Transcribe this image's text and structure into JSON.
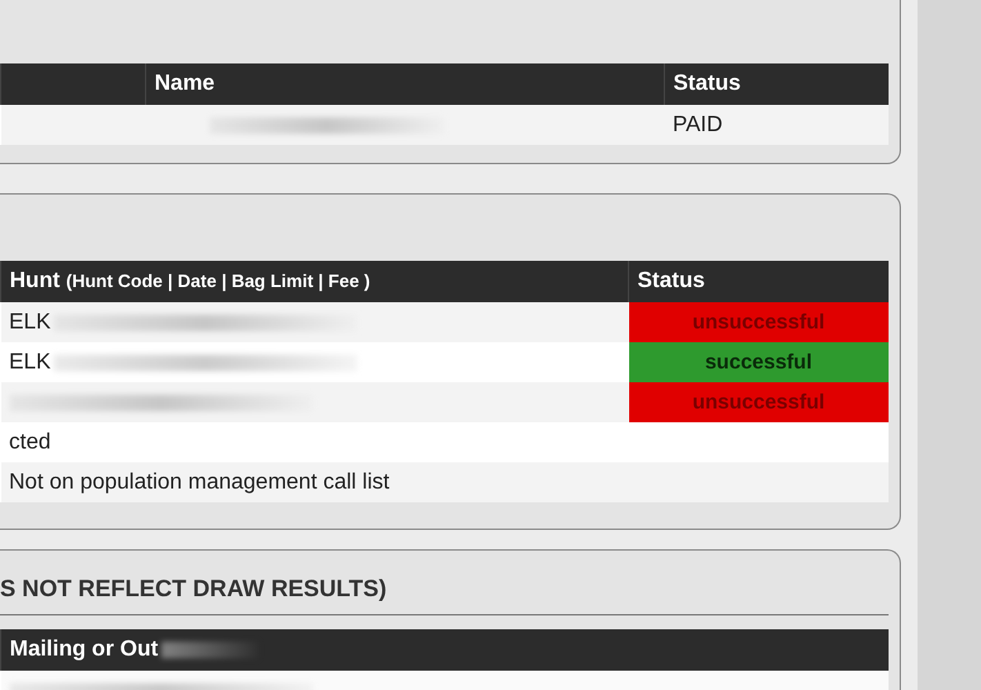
{
  "account_table": {
    "columns": [
      "Name",
      "Status"
    ],
    "rows": [
      {
        "status": "PAID"
      }
    ]
  },
  "hunt_table": {
    "columns": [
      {
        "label": "Hunt",
        "detail": "(Hunt Code | Date | Bag Limit | Fee )"
      },
      {
        "label": "Status"
      }
    ],
    "rows": [
      {
        "hunt": "ELK",
        "status": "unsuccessful",
        "color": "#e00000"
      },
      {
        "hunt": "ELK",
        "status": "successful",
        "color": "#2e9a2e"
      },
      {
        "status": "unsuccessful",
        "color": "#e00000"
      }
    ],
    "notes": [
      "cted",
      "Not on population management call list"
    ]
  },
  "mailing_panel": {
    "title": "S NOT REFLECT DRAW RESULTS)",
    "columns": [
      "Mailing or Out"
    ]
  }
}
